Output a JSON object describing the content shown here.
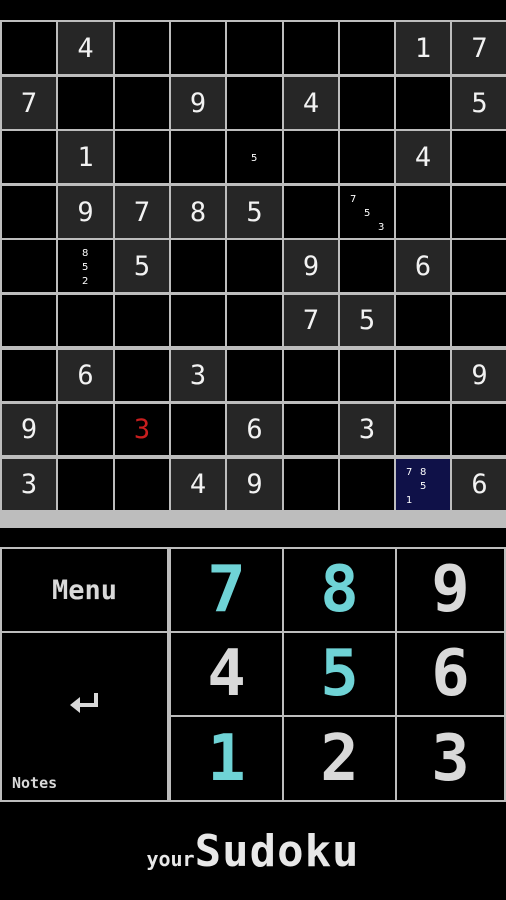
{
  "board": {
    "rows": [
      [
        "",
        "4",
        "",
        "",
        "",
        "",
        "",
        "1",
        "7"
      ],
      [
        "7",
        "",
        "",
        "9",
        "",
        "4",
        "",
        "",
        "5"
      ],
      [
        "",
        "1",
        "",
        "",
        "",
        "",
        "",
        "4",
        ""
      ],
      [
        "",
        "9",
        "7",
        "8",
        "5",
        "",
        "",
        "",
        ""
      ],
      [
        "",
        "",
        "5",
        "",
        "",
        "9",
        "",
        "6",
        ""
      ],
      [
        "",
        "",
        "",
        "",
        "",
        "7",
        "5",
        "",
        ""
      ],
      [
        "",
        "6",
        "",
        "3",
        "",
        "",
        "",
        "",
        "9"
      ],
      [
        "9",
        "",
        "3",
        "",
        "6",
        "",
        "3",
        "",
        ""
      ],
      [
        "3",
        "",
        "",
        "4",
        "9",
        "",
        "",
        "",
        "6"
      ]
    ],
    "givens": [
      [
        false,
        true,
        false,
        false,
        false,
        false,
        false,
        true,
        true
      ],
      [
        true,
        false,
        false,
        true,
        false,
        true,
        false,
        false,
        true
      ],
      [
        false,
        true,
        false,
        false,
        false,
        false,
        false,
        true,
        false
      ],
      [
        false,
        true,
        true,
        true,
        true,
        false,
        false,
        false,
        false
      ],
      [
        false,
        false,
        true,
        false,
        false,
        true,
        false,
        true,
        false
      ],
      [
        false,
        false,
        false,
        false,
        false,
        true,
        true,
        false,
        false
      ],
      [
        false,
        true,
        false,
        true,
        false,
        false,
        false,
        false,
        true
      ],
      [
        true,
        false,
        false,
        false,
        true,
        false,
        true,
        false,
        false
      ],
      [
        true,
        false,
        false,
        true,
        true,
        false,
        false,
        false,
        true
      ]
    ],
    "error_cells": [
      [
        7,
        2
      ]
    ],
    "selected_cell": [
      8,
      7
    ],
    "notes": [
      {
        "row": 2,
        "col": 4,
        "digits": [
          "5"
        ]
      },
      {
        "row": 3,
        "col": 6,
        "digits": [
          "7",
          "5",
          "3"
        ]
      },
      {
        "row": 4,
        "col": 1,
        "digits": [
          "8",
          "5",
          "2"
        ]
      },
      {
        "row": 8,
        "col": 7,
        "digits": [
          "7",
          "8",
          "5",
          "1"
        ]
      }
    ]
  },
  "keypad": {
    "menu_label": "Menu",
    "notes_label": "Notes",
    "enter_icon": "enter-return-icon",
    "digits": [
      {
        "label": "7",
        "color": "#6fd3d6"
      },
      {
        "label": "8",
        "color": "#6fd3d6"
      },
      {
        "label": "9",
        "color": "#d9d9d9"
      },
      {
        "label": "4",
        "color": "#d9d9d9"
      },
      {
        "label": "5",
        "color": "#6fd3d6"
      },
      {
        "label": "6",
        "color": "#d9d9d9"
      },
      {
        "label": "1",
        "color": "#6fd3d6"
      },
      {
        "label": "2",
        "color": "#d9d9d9"
      },
      {
        "label": "3",
        "color": "#d9d9d9"
      }
    ]
  },
  "branding": {
    "prefix": "your",
    "name": "Sudoku"
  },
  "colors": {
    "given_cell": "#262626",
    "empty_cell": "#000000",
    "selected_cell": "#0f1148",
    "error_digit": "#c81e1e",
    "grid_line": "#bdbdbd"
  }
}
